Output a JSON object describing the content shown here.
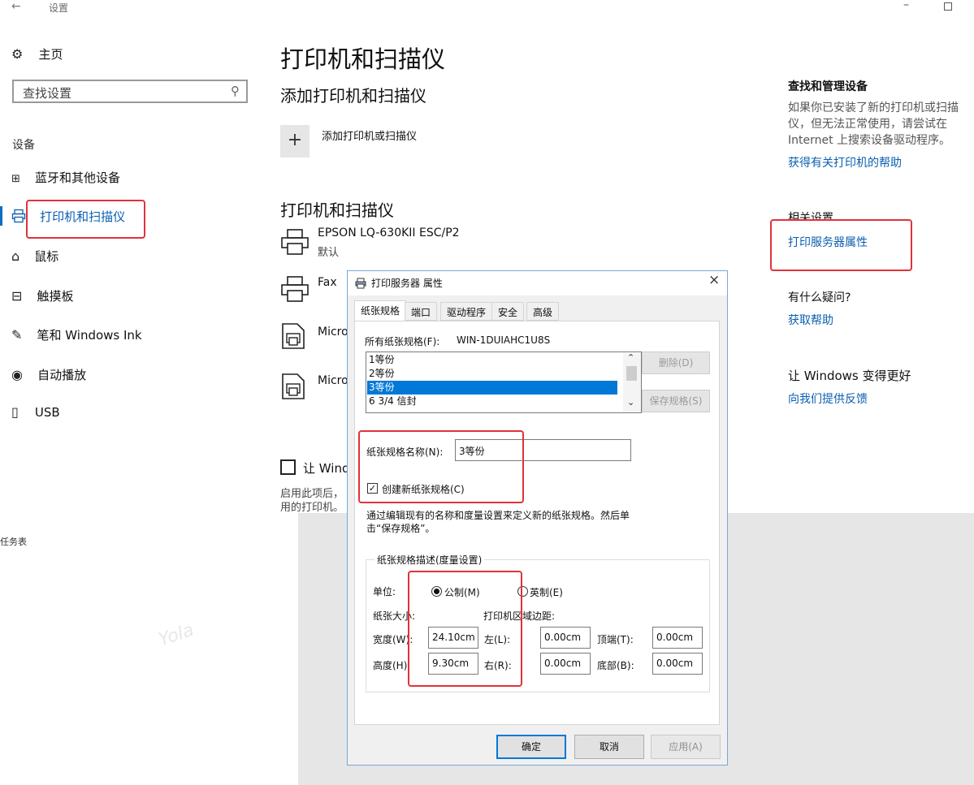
{
  "titlebar": {
    "back": "←",
    "title": "设置",
    "minimize": "–"
  },
  "nav": {
    "home": "主页",
    "search_placeholder": "查找设置",
    "section": "设备",
    "items": [
      {
        "label": "蓝牙和其他设备",
        "icon": "bluetooth-devices-icon"
      },
      {
        "label": "打印机和扫描仪",
        "icon": "printer-icon",
        "selected": true
      },
      {
        "label": "鼠标",
        "icon": "mouse-icon"
      },
      {
        "label": "触摸板",
        "icon": "touchpad-icon"
      },
      {
        "label": "笔和 Windows Ink",
        "icon": "pen-icon"
      },
      {
        "label": "自动播放",
        "icon": "autoplay-icon"
      },
      {
        "label": "USB",
        "icon": "usb-icon"
      }
    ],
    "task_label": "任务表"
  },
  "main": {
    "title": "打印机和扫描仪",
    "add_heading": "添加打印机和扫描仪",
    "add_button": "添加打印机或扫描仪",
    "list_heading": "打印机和扫描仪",
    "printers": [
      {
        "name": "EPSON LQ-630KII ESC/P2",
        "status": "默认"
      },
      {
        "name": "Fax",
        "status": ""
      },
      {
        "name": "Micro",
        "status": ""
      },
      {
        "name": "Micro",
        "status": ""
      }
    ],
    "checkbox_label": "让 Wind",
    "desc_line1": "启用此项后，",
    "desc_line2": "用的打印机。"
  },
  "right": {
    "find_heading": "查找和管理设备",
    "find_text_1": "如果你已安装了新的打印机或扫描",
    "find_text_2": "仪，但无法正常使用，请尝试在",
    "find_text_3": "Internet 上搜索设备驱动程序。",
    "find_link": "获得有关打印机的帮助",
    "related_heading": "相关设置",
    "related_link": "打印服务器属性",
    "help_heading": "有什么疑问?",
    "help_link": "获取帮助",
    "improve_heading": "让 Windows 变得更好",
    "improve_link": "向我们提供反馈"
  },
  "watermark": "Yola",
  "dialog": {
    "title": "打印服务器 属性",
    "close": "×",
    "tabs": [
      "纸张规格",
      "端口",
      "驱动程序",
      "安全",
      "高级"
    ],
    "all_forms_label": "所有纸张规格(F):",
    "server_name": "WIN-1DUIAHC1U8S",
    "forms": [
      "1等份",
      "2等份",
      "3等份",
      "6 3/4 信封"
    ],
    "selected_form": "3等份",
    "delete_btn": "删除(D)",
    "save_btn": "保存规格(S)",
    "form_name_label": "纸张规格名称(N):",
    "form_name_value": "3等份",
    "create_new_label": "创建新纸张规格(C)",
    "create_new_checked": true,
    "hint_1": "通过编辑现有的名称和度量设置来定义新的纸张规格。然后单",
    "hint_2": "击“保存规格”。",
    "group_title": "纸张规格描述(度量设置)",
    "unit_label": "单位:",
    "metric_label": "公制(M)",
    "english_label": "英制(E)",
    "unit_selected": "metric",
    "paper_size_label": "纸张大小:",
    "margins_label": "打印机区域边距:",
    "width_label": "宽度(W):",
    "width_value": "24.10cm",
    "height_label": "高度(H):",
    "height_value": "9.30cm",
    "left_label": "左(L):",
    "left_value": "0.00cm",
    "right_label": "右(R):",
    "right_value": "0.00cm",
    "top_label": "顶端(T):",
    "top_value": "0.00cm",
    "bottom_label": "底部(B):",
    "bottom_value": "0.00cm",
    "ok_btn": "确定",
    "cancel_btn": "取消",
    "apply_btn": "应用(A)"
  }
}
